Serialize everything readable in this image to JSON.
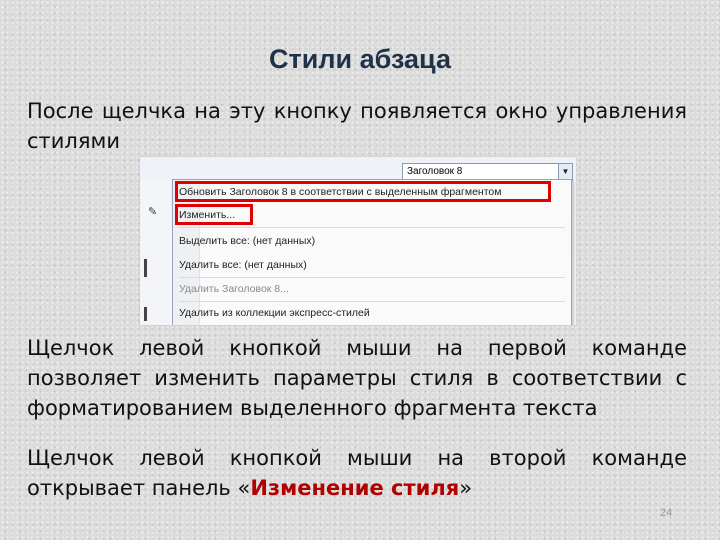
{
  "slide": {
    "title": "Стили абзаца",
    "intro": "После щелчка на эту кнопку появляется окно управления стилями",
    "para2": "Щелчок левой кнопкой мыши на первой команде позволяет изменить параметры стиля в соответствии с форматированием выделенного фрагмента текста",
    "para3_before": "Щелчок левой кнопкой мыши на второй команде открывает панель «",
    "para3_strong": "Изменение стиля",
    "para3_after": "»",
    "page_number": "24"
  },
  "screenshot": {
    "style_selector_value": "Заголовок 8",
    "menu_items": [
      "Обновить Заголовок 8 в соответствии с выделенным фрагментом",
      "Изменить...",
      "Выделить все: (нет данных)",
      "Удалить все: (нет данных)",
      "Удалить Заголовок 8...",
      "Удалить из коллекции экспресс-стилей"
    ],
    "icons": [
      "dropdown-arrow-icon",
      "edit-style-icon"
    ],
    "highlight_color": "#e00000"
  }
}
